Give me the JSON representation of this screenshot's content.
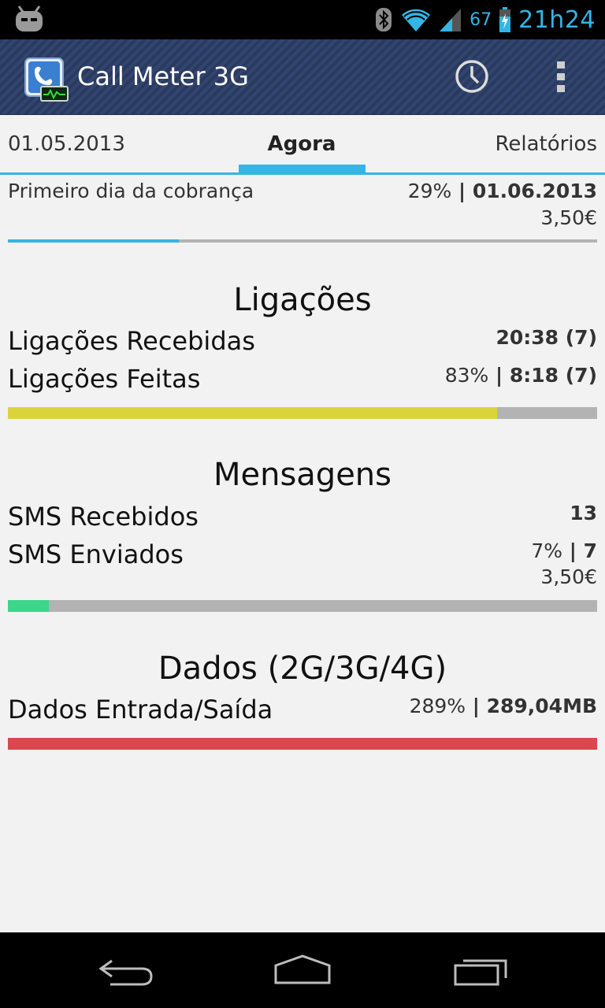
{
  "status_bar": {
    "left_icon": "cyanogenmod-android-icon",
    "icons": [
      "bluetooth-icon",
      "wifi-icon",
      "signal-icon",
      "battery-charging-icon"
    ],
    "battery": "67",
    "time": "21h24"
  },
  "action_bar": {
    "app_icon": "call-meter-phone-icon",
    "title": "Call Meter 3G",
    "history_icon": "clock-icon",
    "overflow_icon": "overflow-menu-icon"
  },
  "tabs": {
    "left": "01.05.2013",
    "center": "Agora",
    "right": "Relatórios"
  },
  "billing": {
    "label": "Primeiro dia da cobrança",
    "percent": "29%",
    "separator": " | ",
    "date": "01.06.2013",
    "cost": "3,50€",
    "progress": 0.29,
    "color": "#33b5e5"
  },
  "calls": {
    "title": "Ligações",
    "received_label": "Ligações Recebidas",
    "received_value": "20:38 (7)",
    "made_label": "Ligações Feitas",
    "made_percent": "83%",
    "separator": " | ",
    "made_value": "8:18 (7)",
    "progress": 0.83,
    "color": "#d9d43a"
  },
  "messages": {
    "title": "Mensagens",
    "received_label": "SMS Recebidos",
    "received_value": "13",
    "sent_label": "SMS Enviados",
    "sent_percent": "7%",
    "separator": " | ",
    "sent_value": "7",
    "cost": "3,50€",
    "progress": 0.07,
    "color": "#3dd68a"
  },
  "data": {
    "title": "Dados (2G/3G/4G)",
    "label": "Dados Entrada/Saída",
    "percent": "289%",
    "separator": " | ",
    "value": "289,04MB",
    "progress": 1.0,
    "color": "#d9474f"
  },
  "nav_bar": {
    "back": "back-icon",
    "home": "home-icon",
    "recents": "recent-apps-icon"
  }
}
